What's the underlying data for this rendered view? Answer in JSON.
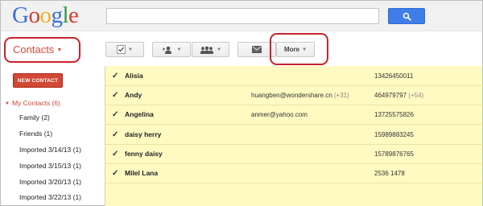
{
  "header": {
    "logo": [
      "G",
      "o",
      "o",
      "g",
      "l",
      "e"
    ],
    "search": {
      "value": "",
      "placeholder": ""
    }
  },
  "toolbar": {
    "contacts_label": "Contacts",
    "more_label": "More"
  },
  "sidebar": {
    "new_contact_label": "NEW CONTACT",
    "items": [
      {
        "label": "My Contacts (6)",
        "active": true
      },
      {
        "label": "Family (2)"
      },
      {
        "label": "Friends (1)"
      },
      {
        "label": "Imported 3/14/13 (1)"
      },
      {
        "label": "Imported 3/15/13 (1)"
      },
      {
        "label": "Imported 3/20/13 (1)"
      },
      {
        "label": "Imported 3/22/13 (1)"
      }
    ]
  },
  "contacts": [
    {
      "name": "Alisia",
      "email": "",
      "email_extra": "",
      "phone": "13426450011",
      "phone_extra": ""
    },
    {
      "name": "Andy",
      "email": "huangben@wondershare.cn",
      "email_extra": "(+31)",
      "phone": "464979797",
      "phone_extra": "(+54)"
    },
    {
      "name": "Angelina",
      "email": "anmer@yahoo.com",
      "email_extra": "",
      "phone": "13725575826",
      "phone_extra": ""
    },
    {
      "name": "daisy herry",
      "email": "",
      "email_extra": "",
      "phone": "15989883245",
      "phone_extra": ""
    },
    {
      "name": "fenny daisy",
      "email": "",
      "email_extra": "",
      "phone": "15789876765",
      "phone_extra": ""
    },
    {
      "name": "Milel Lana",
      "email": "",
      "email_extra": "",
      "phone": "2536 1478",
      "phone_extra": ""
    }
  ],
  "icons": {
    "search": "search-icon",
    "select": "checkbox-icon",
    "add_person": "add-person-icon",
    "add_group": "group-icon",
    "mail": "mail-icon"
  },
  "colors": {
    "brand_red": "#d14836",
    "annotation_red": "#c8232c",
    "row_highlight": "#fffac2",
    "search_blue": "#3f7de8"
  }
}
